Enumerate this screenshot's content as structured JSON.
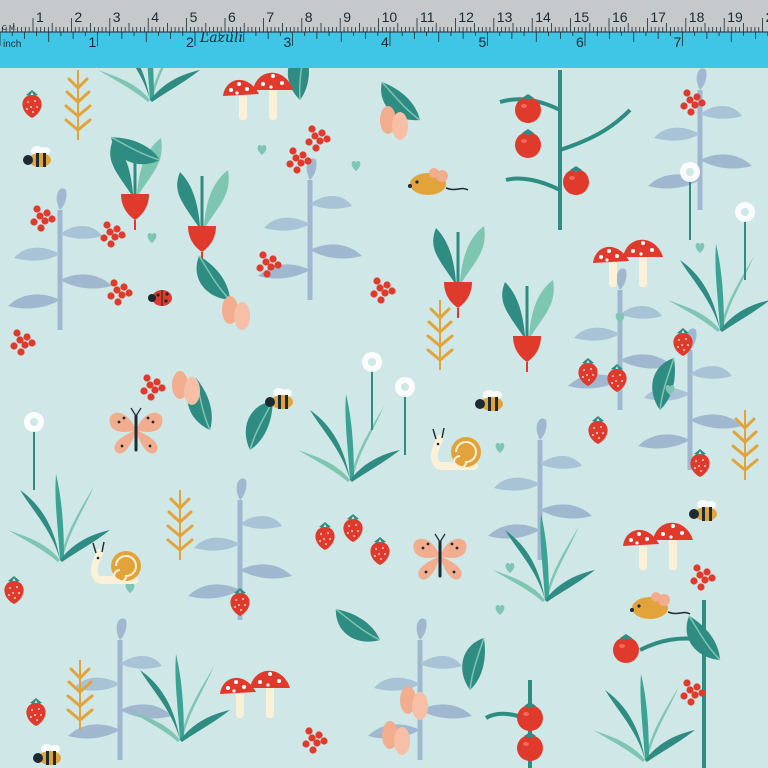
{
  "ruler": {
    "cm_labels": [
      "1",
      "2",
      "3",
      "4",
      "5",
      "6",
      "7",
      "8",
      "9",
      "10",
      "11",
      "12",
      "13",
      "14",
      "15",
      "16",
      "17",
      "18",
      "19",
      "2"
    ],
    "corner_cm_label": "C.M.",
    "inch_unit_label": "inch",
    "inch_labels": [
      "1",
      "2",
      "3",
      "4",
      "5",
      "6",
      "7"
    ],
    "handwritten_note": "Lazuli",
    "colors": {
      "top_strip": "#c5c9cb",
      "inch_strip": "#3fc6e6",
      "ink": "#1b2a33"
    }
  },
  "fabric": {
    "colors": {
      "background": "#cfe7e6",
      "teal_leaf": "#2f8c83",
      "mint_leaf": "#7ec5b2",
      "blue_grey_leaf": "#9fb8cf",
      "berry_red": "#e03a2c",
      "peach": "#f2ac8e",
      "mustard": "#e2a43a",
      "cream": "#fbf0d8"
    },
    "motifs": [
      "strawberry-icon",
      "radish-icon",
      "toadstool-icon",
      "bee-icon",
      "mouse-icon",
      "snail-icon",
      "butterfly-icon",
      "ladybug-icon",
      "tomato-vine-icon",
      "dandelion-icon"
    ]
  }
}
